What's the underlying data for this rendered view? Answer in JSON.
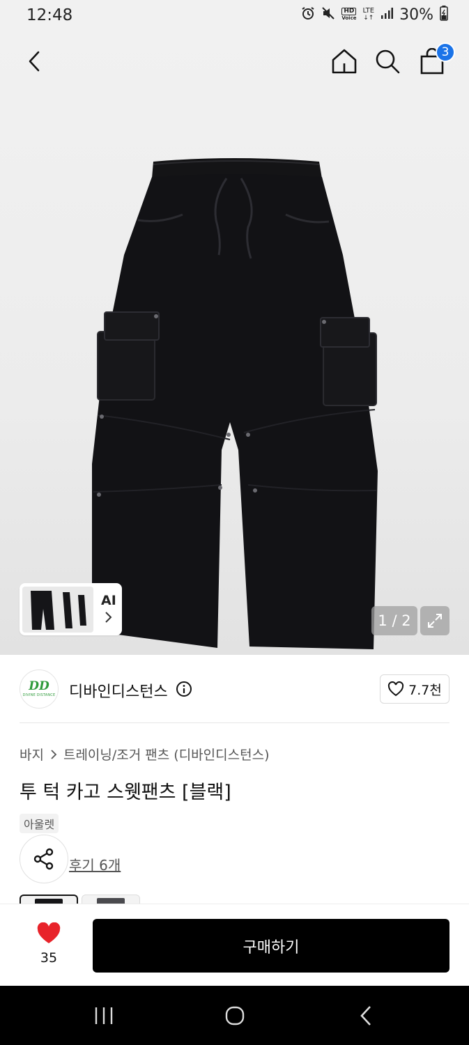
{
  "status_bar": {
    "time": "12:48",
    "battery": "30%",
    "icons": [
      "alarm-icon",
      "mute-icon",
      "hd-voice-icon",
      "lte-icon",
      "signal-icon",
      "battery-charging-icon"
    ],
    "hd_label": "HD",
    "voice_label": "Voice",
    "lte_label": "LTE"
  },
  "top_nav": {
    "icons": [
      "back-arrow-icon",
      "home-icon",
      "search-icon",
      "shopping-bag-icon"
    ],
    "cart_count": "3"
  },
  "gallery": {
    "thumbnail_label": "AI",
    "counter": "1 / 2",
    "image_subject": "black cargo sweatpants"
  },
  "brand": {
    "logo_mark": "DD",
    "logo_text": "DIVINE DISTANCE",
    "name": "디바인디스턴스",
    "like_count": "7.7천"
  },
  "product": {
    "breadcrumb": [
      "바지",
      "트레이닝/조거 팬츠 (디바인디스턴스)"
    ],
    "title": "투 턱 카고 스웻팬츠 [블랙]",
    "tag": "아울렛",
    "review_link": "후기 6개"
  },
  "purchase_bar": {
    "wish_count": "35",
    "buy_label": "구매하기"
  },
  "colors": {
    "accent_blue": "#1a73e8",
    "heart_red": "#e8232a",
    "brand_green": "#2e9a3a",
    "buy_button": "#000000"
  }
}
